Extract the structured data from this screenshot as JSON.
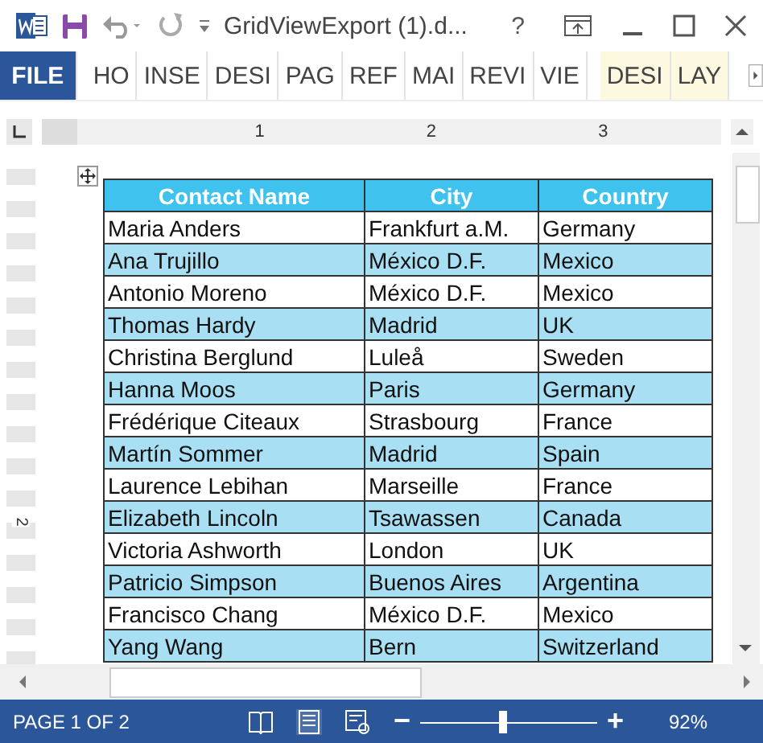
{
  "window": {
    "title": "GridViewExport (1).d...",
    "help": "?"
  },
  "tabs": [
    {
      "label": "FILE",
      "selected": true,
      "kind": "file"
    },
    {
      "label": "HO",
      "selected": false,
      "kind": "normal"
    },
    {
      "label": "INSE",
      "selected": false,
      "kind": "normal"
    },
    {
      "label": "DESI",
      "selected": false,
      "kind": "normal"
    },
    {
      "label": "PAG",
      "selected": false,
      "kind": "normal"
    },
    {
      "label": "REF",
      "selected": false,
      "kind": "normal"
    },
    {
      "label": "MAI",
      "selected": false,
      "kind": "normal"
    },
    {
      "label": "REVI",
      "selected": false,
      "kind": "normal"
    },
    {
      "label": "VIE",
      "selected": false,
      "kind": "normal"
    },
    {
      "label": "DESI",
      "selected": false,
      "kind": "contextual"
    },
    {
      "label": "LAY",
      "selected": false,
      "kind": "contextual"
    }
  ],
  "ruler": {
    "numbers": [
      "1",
      "2",
      "3"
    ],
    "vertical_number": "2"
  },
  "table": {
    "columns": [
      "Contact Name",
      "City",
      "Country"
    ],
    "rows": [
      [
        "Maria Anders",
        "Frankfurt a.M.",
        "Germany"
      ],
      [
        "Ana Trujillo",
        "México D.F.",
        "Mexico"
      ],
      [
        "Antonio Moreno",
        "México D.F.",
        "Mexico"
      ],
      [
        "Thomas Hardy",
        "Madrid",
        "UK"
      ],
      [
        "Christina Berglund",
        "Luleå",
        "Sweden"
      ],
      [
        "Hanna Moos",
        "Paris",
        "Germany"
      ],
      [
        "Frédérique Citeaux",
        "Strasbourg",
        "France"
      ],
      [
        "Martín Sommer",
        "Madrid",
        "Spain"
      ],
      [
        "Laurence Lebihan",
        "Marseille",
        "France"
      ],
      [
        "Elizabeth Lincoln",
        "Tsawassen",
        "Canada"
      ],
      [
        "Victoria Ashworth",
        "London",
        "UK"
      ],
      [
        "Patricio Simpson",
        "Buenos Aires",
        "Argentina"
      ],
      [
        "Francisco Chang",
        "México D.F.",
        "Mexico"
      ],
      [
        "Yang Wang",
        "Bern",
        "Switzerland"
      ]
    ]
  },
  "status_bar": {
    "page": "PAGE 1 OF 2",
    "zoom": {
      "minus": "−",
      "plus": "+",
      "level": 0.46,
      "reading": "92%"
    }
  }
}
